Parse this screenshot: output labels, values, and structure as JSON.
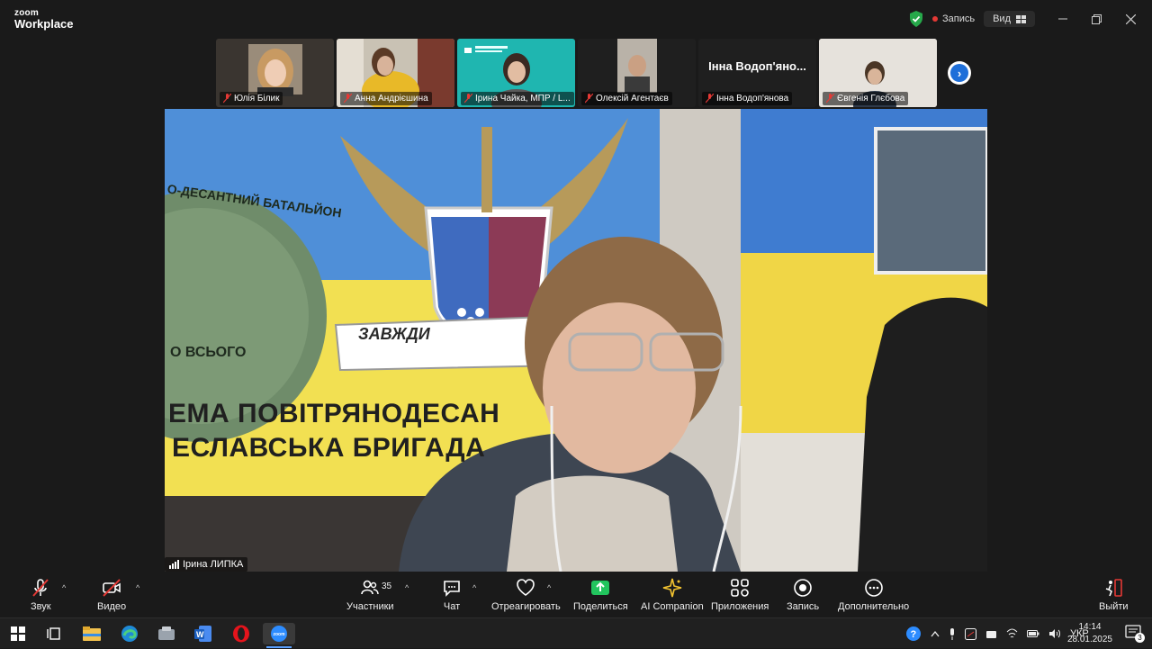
{
  "app": {
    "logo_line1": "zoom",
    "logo_line2": "Workplace",
    "recording_label": "Запись",
    "view_label": "Вид",
    "colors": {
      "accent": "#1e6fd9",
      "record": "#e53935",
      "secure": "#26a84a",
      "share": "#22c55e"
    }
  },
  "thumbnails": [
    {
      "name": "Юлія Білик"
    },
    {
      "name": "Анна Андрієшина"
    },
    {
      "name": "Ірина Чайка, МПР / L..."
    },
    {
      "name": "Олексій Агентаєв"
    },
    {
      "name": "Інна Водоп'янова",
      "card_text": "Інна Водоп'яно..."
    },
    {
      "name": "Євгенія Глєбова"
    }
  ],
  "next_icon": "chevron-right-icon",
  "main_video": {
    "speaker": "Ірина ЛИПКА",
    "flag_text_line1": "ЕМА ПОВІТРЯНОДЕСАН",
    "flag_text_line2": "ЕСЛАВСЬКА БРИГАДА",
    "ribbon_text": "ЗАВЖДИ",
    "emblem_text": "О-ДЕСАНТНИЙ БАТАЛЬЙОН",
    "emblem_bottom": "О ВСЬОГО"
  },
  "toolbar": {
    "audio": "Звук",
    "video": "Видео",
    "participants": "Участники",
    "participants_count": "35",
    "chat": "Чат",
    "react": "Отреагировать",
    "share": "Поделиться",
    "ai": "AI Companion",
    "apps": "Приложения",
    "record": "Запись",
    "more": "Дополнительно",
    "leave": "Выйти"
  },
  "taskbar": {
    "language": "УКР",
    "time": "14:14",
    "date": "28.01.2025",
    "notifications": "3",
    "apps": [
      "windows-icon",
      "task-view-icon",
      "file-explorer-icon",
      "edge-icon",
      "app-icon",
      "word-icon",
      "opera-icon",
      "zoom-icon"
    ]
  }
}
